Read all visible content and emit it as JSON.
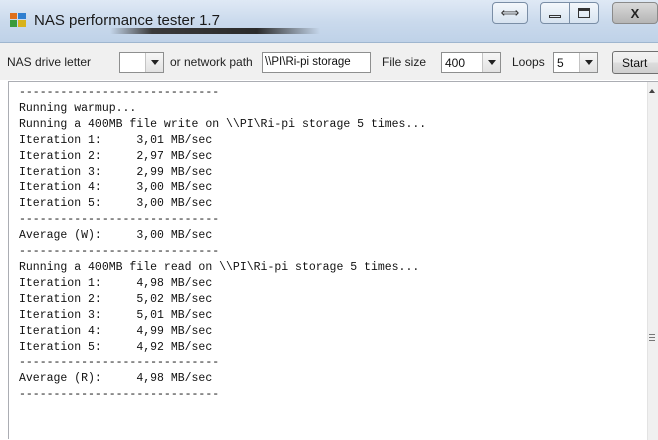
{
  "window": {
    "title": "NAS performance tester 1.7",
    "icons": {
      "app": "app-icon",
      "snap": "snap-icon",
      "minimize": "minimize-icon",
      "maximize": "maximize-icon",
      "close": "close-icon"
    },
    "close_label": "X",
    "snap_label": "⟺"
  },
  "toolbar": {
    "drive_label": "NAS drive letter",
    "drive_value": "",
    "network_label": "or network path",
    "network_value": "\\\\PI\\Ri-pi storage",
    "filesize_label": "File size",
    "filesize_value": "400",
    "loops_label": "Loops",
    "loops_value": "5",
    "start_label": "Start"
  },
  "output": {
    "lines": [
      "-----------------------------",
      "Running warmup...",
      "Running a 400MB file write on \\\\PI\\Ri-pi storage 5 times...",
      "Iteration 1:     3,01 MB/sec",
      "Iteration 2:     2,97 MB/sec",
      "Iteration 3:     2,99 MB/sec",
      "Iteration 4:     3,00 MB/sec",
      "Iteration 5:     3,00 MB/sec",
      "-----------------------------",
      "Average (W):     3,00 MB/sec",
      "-----------------------------",
      "Running a 400MB file read on \\\\PI\\Ri-pi storage 5 times...",
      "Iteration 1:     4,98 MB/sec",
      "Iteration 2:     5,02 MB/sec",
      "Iteration 3:     5,01 MB/sec",
      "Iteration 4:     4,99 MB/sec",
      "Iteration 5:     4,92 MB/sec",
      "-----------------------------",
      "Average (R):     4,98 MB/sec",
      "-----------------------------"
    ]
  }
}
